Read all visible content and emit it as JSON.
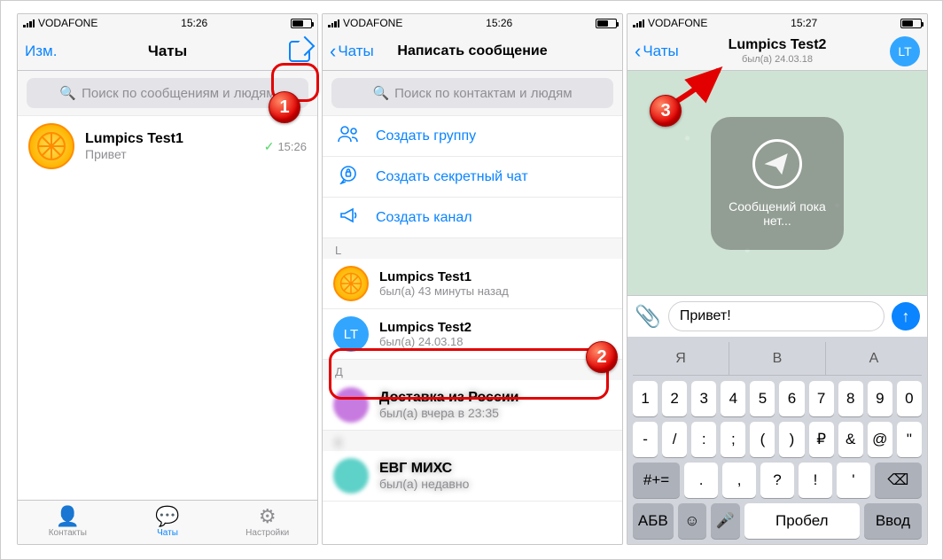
{
  "statusbar": {
    "carrier": "VODAFONE",
    "time1": "15:26",
    "time2": "15:26",
    "time3": "15:27",
    "battery_pct": 55
  },
  "screen1": {
    "edit": "Изм.",
    "title": "Чаты",
    "search_placeholder": "Поиск по сообщениям и людям",
    "chat": {
      "name": "Lumpics Test1",
      "preview": "Привет",
      "time": "15:26"
    },
    "tabs": {
      "contacts": "Контакты",
      "chats": "Чаты",
      "settings": "Настройки"
    }
  },
  "screen2": {
    "back": "Чаты",
    "title": "Написать сообщение",
    "search_placeholder": "Поиск по контактам и людям",
    "actions": {
      "group": "Создать группу",
      "secret": "Создать секретный чат",
      "channel": "Создать канал"
    },
    "section_L": "L",
    "contacts": [
      {
        "name": "Lumpics Test1",
        "status": "был(а) 43 минуты назад",
        "avatar_type": "lemon"
      },
      {
        "name": "Lumpics Test2",
        "status": "был(а) 24.03.18",
        "avatar_type": "lt",
        "initials": "LT"
      }
    ],
    "section_D": "Д"
  },
  "screen3": {
    "back": "Чаты",
    "title": "Lumpics Test2",
    "subtitle": "был(а) 24.03.18",
    "avatar_initials": "LT",
    "empty_text": "Сообщений пока нет...",
    "input_value": "Привет!",
    "predictions": [
      "Я",
      "В",
      "А"
    ],
    "keys_abc": "АБВ",
    "keys_symbols": "#+=",
    "key_space": "Пробел",
    "key_return": "Ввод"
  },
  "badges": {
    "b1": "1",
    "b2": "2",
    "b3": "3"
  }
}
